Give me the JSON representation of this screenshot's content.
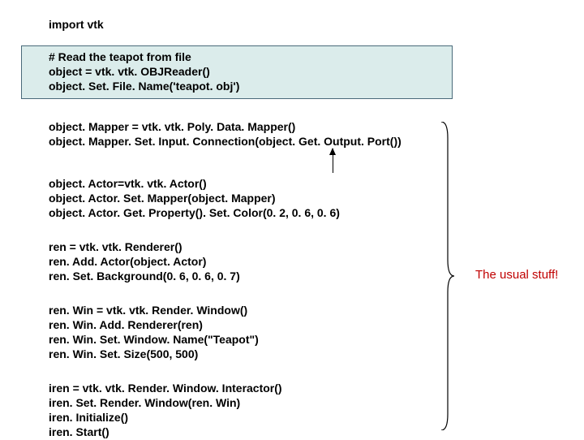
{
  "code": {
    "l1": "import vtk",
    "l2": "# Read the teapot from file",
    "l3": "object = vtk. vtk. OBJReader()",
    "l4": "object. Set. File. Name('teapot. obj')",
    "l5": "object. Mapper = vtk. vtk. Poly. Data. Mapper()",
    "l6": "object. Mapper. Set. Input. Connection(object. Get. Output. Port())",
    "l7": "object. Actor=vtk. vtk. Actor()",
    "l8": "object. Actor. Set. Mapper(object. Mapper)",
    "l9": "object. Actor. Get. Property(). Set. Color(0. 2, 0. 6, 0. 6)",
    "l10": "ren = vtk. vtk. Renderer()",
    "l11": "ren. Add. Actor(object. Actor)",
    "l12": "ren. Set. Background(0. 6, 0. 6, 0. 7)",
    "l13": "ren. Win = vtk. vtk. Render. Window()",
    "l14": "ren. Win. Add. Renderer(ren)",
    "l15": "ren. Win. Set. Window. Name(\"Teapot\")",
    "l16": "ren. Win. Set. Size(500, 500)",
    "l17": "iren = vtk. vtk. Render. Window. Interactor()",
    "l18": "iren. Set. Render. Window(ren. Win)",
    "l19": "iren. Initialize()",
    "l20": "iren. Start()"
  },
  "annotation": "The usual stuff!"
}
